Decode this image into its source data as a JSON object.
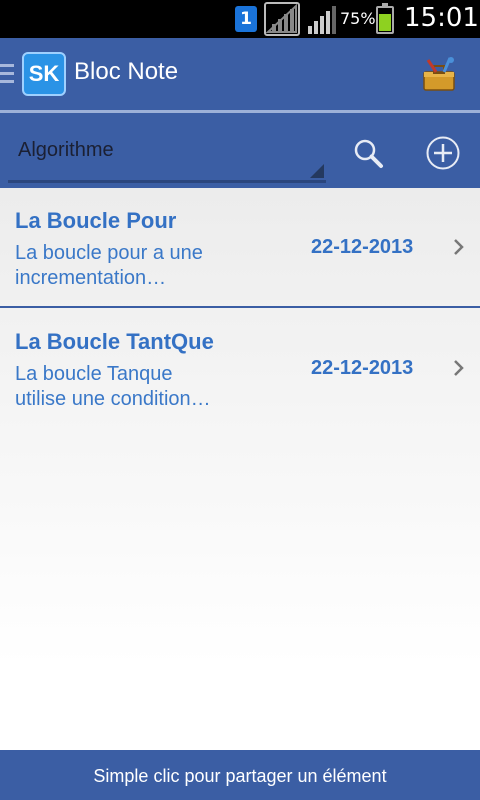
{
  "status_bar": {
    "sim_label": "1",
    "battery_percent": "75%",
    "battery_level": 0.75,
    "time": "15:01"
  },
  "action_bar": {
    "logo_text": "SK",
    "title": "Bloc Note",
    "icons": {
      "drawer": "drawer-icon",
      "tools": "toolbox-icon"
    }
  },
  "toolbar": {
    "category": "Algorithme",
    "icons": {
      "search": "search-icon",
      "add": "add-circle-icon"
    }
  },
  "notes": [
    {
      "title": "La Boucle Pour",
      "desc_line1": "La boucle pour a une",
      "desc_line2": "incrementation…",
      "date": "22-12-2013"
    },
    {
      "title": "La Boucle TantQue",
      "desc_line1": "La boucle Tanque",
      "desc_line2": "utilise une condition…",
      "date": "22-12-2013"
    }
  ],
  "footer": {
    "hint": "Simple clic pour partager un élément"
  },
  "colors": {
    "primary": "#3b5ea4",
    "accent_text": "#3471c4",
    "status_bar": "#000000"
  }
}
